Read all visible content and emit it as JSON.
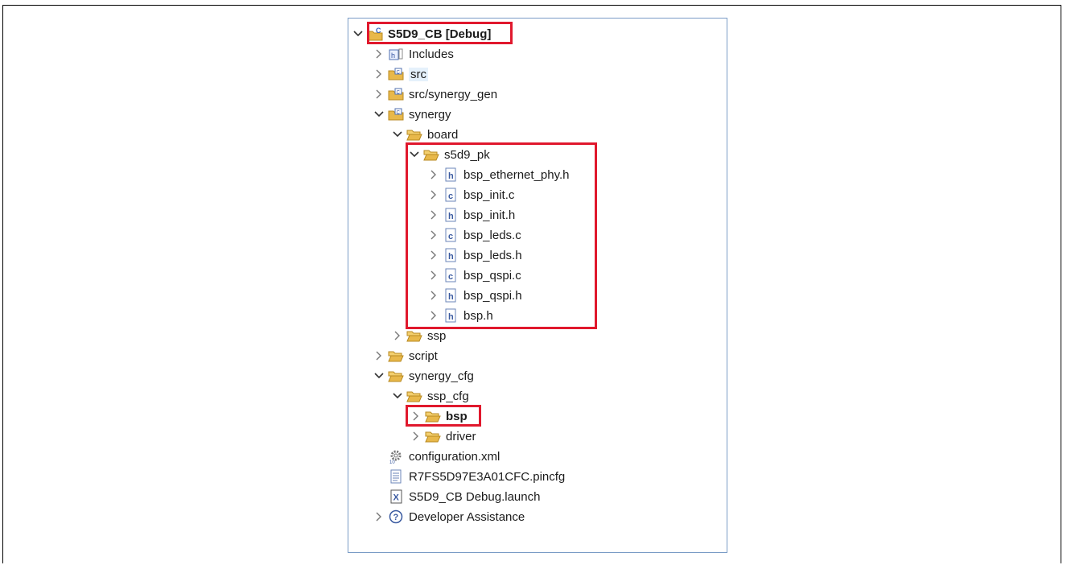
{
  "tree": {
    "root": {
      "label": "S5D9_CB [Debug]"
    },
    "includes": "Includes",
    "src": "src",
    "src_gen": "src/synergy_gen",
    "synergy": "synergy",
    "board": "board",
    "s5d9_pk": "s5d9_pk",
    "files": [
      "bsp_ethernet_phy.h",
      "bsp_init.c",
      "bsp_init.h",
      "bsp_leds.c",
      "bsp_leds.h",
      "bsp_qspi.c",
      "bsp_qspi.h",
      "bsp.h"
    ],
    "ssp": "ssp",
    "script": "script",
    "synergy_cfg": "synergy_cfg",
    "ssp_cfg": "ssp_cfg",
    "bsp": "bsp",
    "driver": "driver",
    "configuration": "configuration.xml",
    "pincfg": "R7FS5D97E3A01CFC.pincfg",
    "launch": "S5D9_CB Debug.launch",
    "dev_assist": "Developer Assistance"
  },
  "colors": {
    "highlight": "#e0182d",
    "panel_border": "#7a9cc6",
    "folder": "#e8b84a"
  },
  "icons": {
    "expanded": "chevron-down-icon",
    "collapsed": "chevron-right-icon",
    "folder": "folder-icon",
    "source_folder": "source-folder-icon",
    "header_file": "header-file-icon",
    "c_file": "c-file-icon",
    "project": "c-project-icon"
  }
}
